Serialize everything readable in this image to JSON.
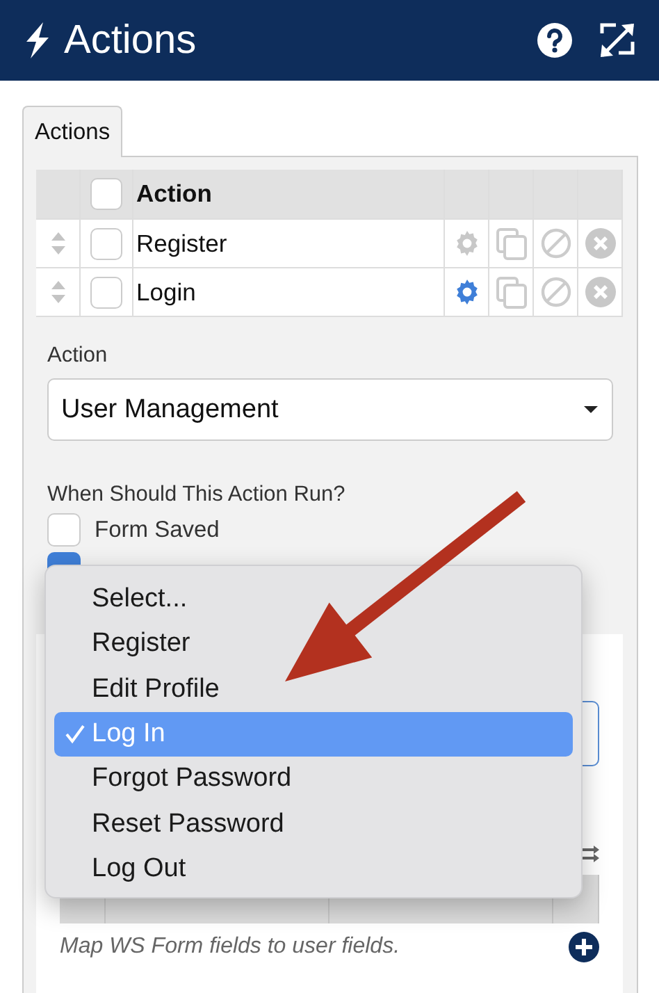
{
  "header": {
    "title": "Actions"
  },
  "tabs": [
    {
      "label": "Actions",
      "selected": true
    }
  ],
  "actions_table": {
    "columns": [
      "Action"
    ],
    "select_all_checked": false,
    "rows": [
      {
        "label": "Register",
        "checked": false,
        "settings_active": false
      },
      {
        "label": "Login",
        "checked": false,
        "settings_active": true
      }
    ]
  },
  "action_field": {
    "label": "Action",
    "value": "User Management"
  },
  "run_when": {
    "label": "When Should This Action Run?",
    "options": [
      {
        "label": "Form Saved",
        "checked": false
      },
      {
        "checked": true
      }
    ]
  },
  "mapping": {
    "note": "Map WS Form fields to user fields."
  },
  "dropdown_menu": {
    "items": [
      {
        "label": "Select...",
        "selected": false
      },
      {
        "label": "Register",
        "selected": false
      },
      {
        "label": "Edit Profile",
        "selected": false
      },
      {
        "label": "Log In",
        "selected": true
      },
      {
        "label": "Forgot Password",
        "selected": false
      },
      {
        "label": "Reset Password",
        "selected": false
      },
      {
        "label": "Log Out",
        "selected": false
      }
    ]
  }
}
